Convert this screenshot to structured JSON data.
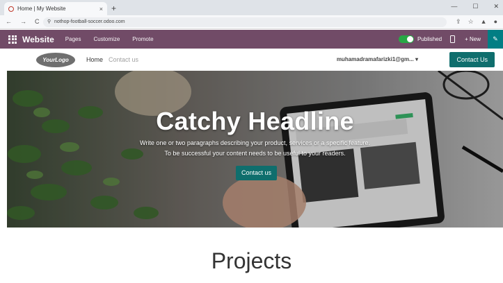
{
  "browser": {
    "tab_title": "Home | My Website",
    "tab_close": "×",
    "new_tab": "+",
    "url": "nothop-football-soccer.odoo.com",
    "window_controls": [
      "—",
      "☐",
      "✕"
    ],
    "nav_icons": [
      "←",
      "→",
      "C"
    ],
    "extension_icons": [
      "⇪",
      "☆",
      "▲",
      "●"
    ]
  },
  "odoo_bar": {
    "brand": "Website",
    "menu": [
      "Pages",
      "Customize",
      "Promote"
    ],
    "published_label": "Published",
    "new_label": "+ New",
    "edit_icon": "✎",
    "colors": {
      "bar": "#714b67",
      "toggle": "#28a745",
      "edit": "#017e84"
    }
  },
  "site_header": {
    "logo_text": "YourLogo",
    "nav": [
      "Home",
      "Contact us"
    ],
    "user": "muhamadramafarizki1@gm... ▾",
    "cta": "Contact Us"
  },
  "hero": {
    "title": "Catchy Headline",
    "text_line1": "Write one or two paragraphs describing your product, services or a specific feature.",
    "text_line2": "To be successful your content needs to be useful to your readers.",
    "button": "Contact us",
    "accent": "#0f6e6d"
  },
  "projects": {
    "title": "Projects"
  }
}
